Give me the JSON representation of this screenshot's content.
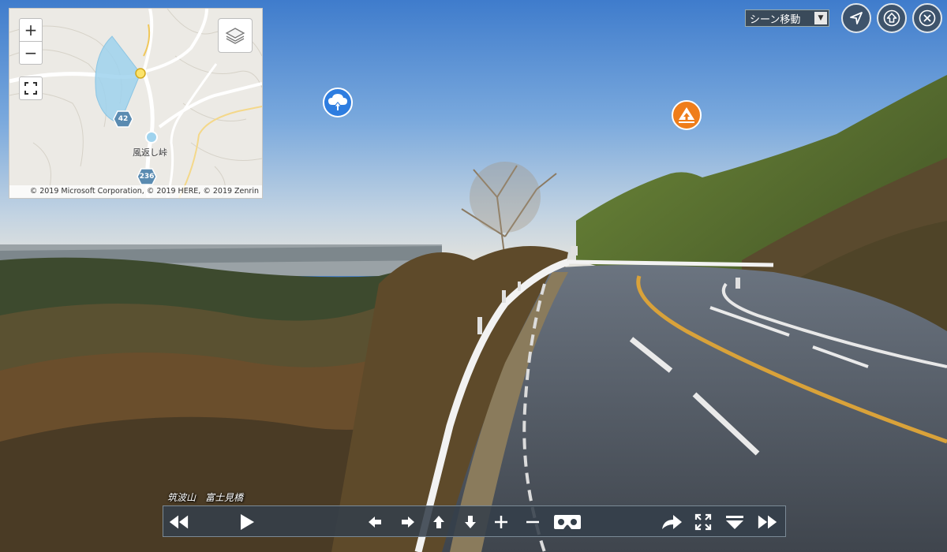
{
  "minimap": {
    "zoom_in_label": "+",
    "zoom_out_label": "−",
    "place_label": "風返し峠",
    "route_shields": [
      "42",
      "236"
    ],
    "credit": "© 2019 Microsoft Corporation, © 2019 HERE, © 2019 Zenrin"
  },
  "scene_select": {
    "value": "シーン移動"
  },
  "caption": "筑波山　富士見橋",
  "icons": {
    "hotspot_blue": "cloud-up-icon",
    "hotspot_orange": "mountain-up-icon",
    "nav": "navigation-arrow-icon",
    "up": "up-arrow-icon",
    "close": "close-icon"
  },
  "colors": {
    "hotspot_blue": "#2e7de0",
    "hotspot_orange": "#ef7d1a",
    "toolbar_bg": "#343f4a",
    "map_view_cone": "#9fd3ee"
  }
}
